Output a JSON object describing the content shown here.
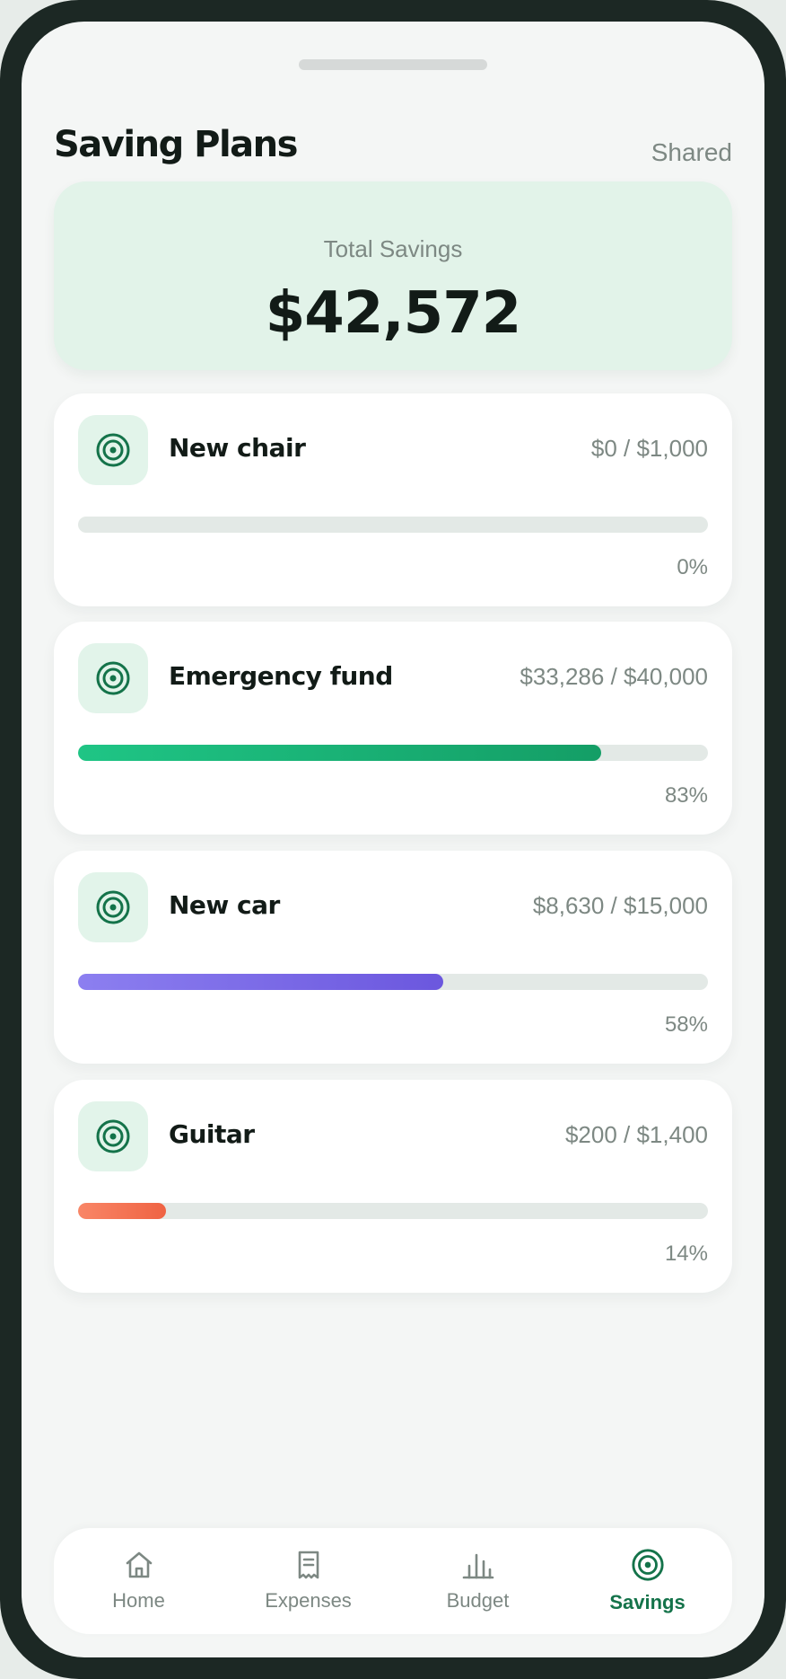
{
  "header": {
    "title": "Saving Plans",
    "shared_label": "Shared"
  },
  "summary": {
    "label": "Total Savings",
    "amount": "$42,572"
  },
  "plans": [
    {
      "name": "New chair",
      "amount": "$0 / $1,000",
      "percent_label": "0%",
      "progress": 0.0,
      "colors": [
        "#1fc281",
        "#1fc281"
      ],
      "icon": "target-icon"
    },
    {
      "name": "Emergency fund",
      "amount": "$33,286 / $40,000",
      "percent_label": "83%",
      "progress": 0.83,
      "colors": [
        "#1fc585",
        "#149e66"
      ],
      "icon": "target-icon"
    },
    {
      "name": "New car",
      "amount": "$8,630 / $15,000",
      "percent_label": "58%",
      "progress": 0.58,
      "colors": [
        "#8c7ff0",
        "#6b57de"
      ],
      "icon": "target-icon"
    },
    {
      "name": "Guitar",
      "amount": "$200 / $1,400",
      "percent_label": "14%",
      "progress": 0.14,
      "colors": [
        "#f98667",
        "#ef6343"
      ],
      "icon": "target-icon"
    }
  ],
  "nav": {
    "items": [
      {
        "label": "Home",
        "icon": "home-icon",
        "active": false
      },
      {
        "label": "Expenses",
        "icon": "receipt-icon",
        "active": false
      },
      {
        "label": "Budget",
        "icon": "bar-chart-icon",
        "active": false
      },
      {
        "label": "Savings",
        "icon": "target-icon",
        "active": true
      }
    ]
  },
  "colors": {
    "accent": "#14734a",
    "icon_bg": "#e2f4ea",
    "summary_bg": "#e2f3e9",
    "track": "#e3e9e6",
    "muted_text": "#7d8883",
    "frame": "#1c2824"
  }
}
